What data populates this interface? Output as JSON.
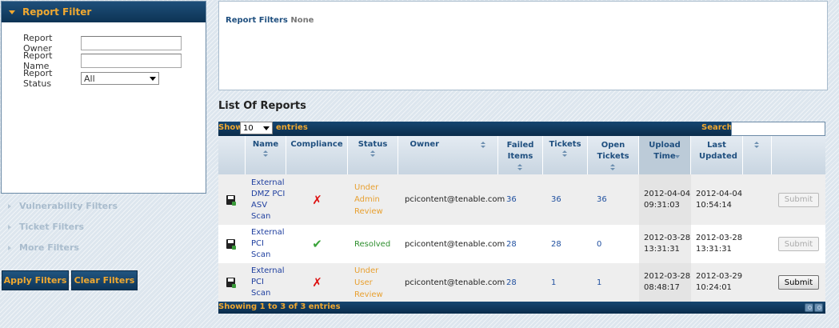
{
  "sidebar": {
    "report_filter": {
      "title": "Report Filter",
      "owner_label": "Report Owner",
      "owner_value": "",
      "name_label": "Report Name",
      "name_value": "",
      "status_label": "Report Status",
      "status_value": "All"
    },
    "collapsed_filters": [
      "Vulnerability Filters",
      "Ticket Filters",
      "More Filters"
    ],
    "apply_label": "Apply Filters",
    "clear_label": "Clear Filters"
  },
  "summary": {
    "label": "Report Filters",
    "value": "None"
  },
  "list_title": "List Of Reports",
  "table_controls": {
    "show_label": "Show",
    "length_value": "10",
    "entries_label": "entries",
    "search_label": "Search:",
    "search_value": ""
  },
  "columns": [
    "",
    "Name",
    "Compliance",
    "Status",
    "Owner",
    "Failed Items",
    "Tickets",
    "Open Tickets",
    "Upload Time",
    "Last Updated",
    "",
    ""
  ],
  "rows": [
    {
      "icon": "floppy-disk-icon",
      "name": [
        "External",
        "DMZ PCI",
        "ASV",
        "Scan"
      ],
      "compliance": "fail",
      "status": [
        "Under",
        "Admin",
        "Review"
      ],
      "status_color": "#e8a030",
      "owner": "pcicontent@tenable.com",
      "failed_items": "36",
      "tickets": "36",
      "open_tickets": "36",
      "upload_time": [
        "2012-04-04",
        "09:31:03"
      ],
      "last_updated": [
        "2012-04-04",
        "10:54:14"
      ],
      "action": "Submit",
      "action_enabled": false
    },
    {
      "icon": "floppy-disk-icon",
      "name": [
        "External",
        "PCI",
        "Scan"
      ],
      "compliance": "pass",
      "status": [
        "Resolved"
      ],
      "status_color": "#2f8f2f",
      "owner": "pcicontent@tenable.com",
      "failed_items": "28",
      "tickets": "28",
      "open_tickets": "0",
      "upload_time": [
        "2012-03-28",
        "13:31:31"
      ],
      "last_updated": [
        "2012-03-28",
        "13:31:31"
      ],
      "action": "Submit",
      "action_enabled": false
    },
    {
      "icon": "floppy-disk-icon",
      "name": [
        "External",
        "PCI",
        "Scan"
      ],
      "compliance": "fail",
      "status": [
        "Under",
        "User",
        "Review"
      ],
      "status_color": "#e8a030",
      "owner": "pcicontent@tenable.com",
      "failed_items": "28",
      "tickets": "1",
      "open_tickets": "1",
      "upload_time": [
        "2012-03-28",
        "08:48:17"
      ],
      "last_updated": [
        "2012-03-29",
        "10:24:01"
      ],
      "action": "Submit",
      "action_enabled": true
    }
  ],
  "table_info": "Showing 1 to 3 of 3 entries",
  "colors": {
    "accent": "#f0a830",
    "header_bg": "#0d3354",
    "link": "#1f4f9f"
  }
}
